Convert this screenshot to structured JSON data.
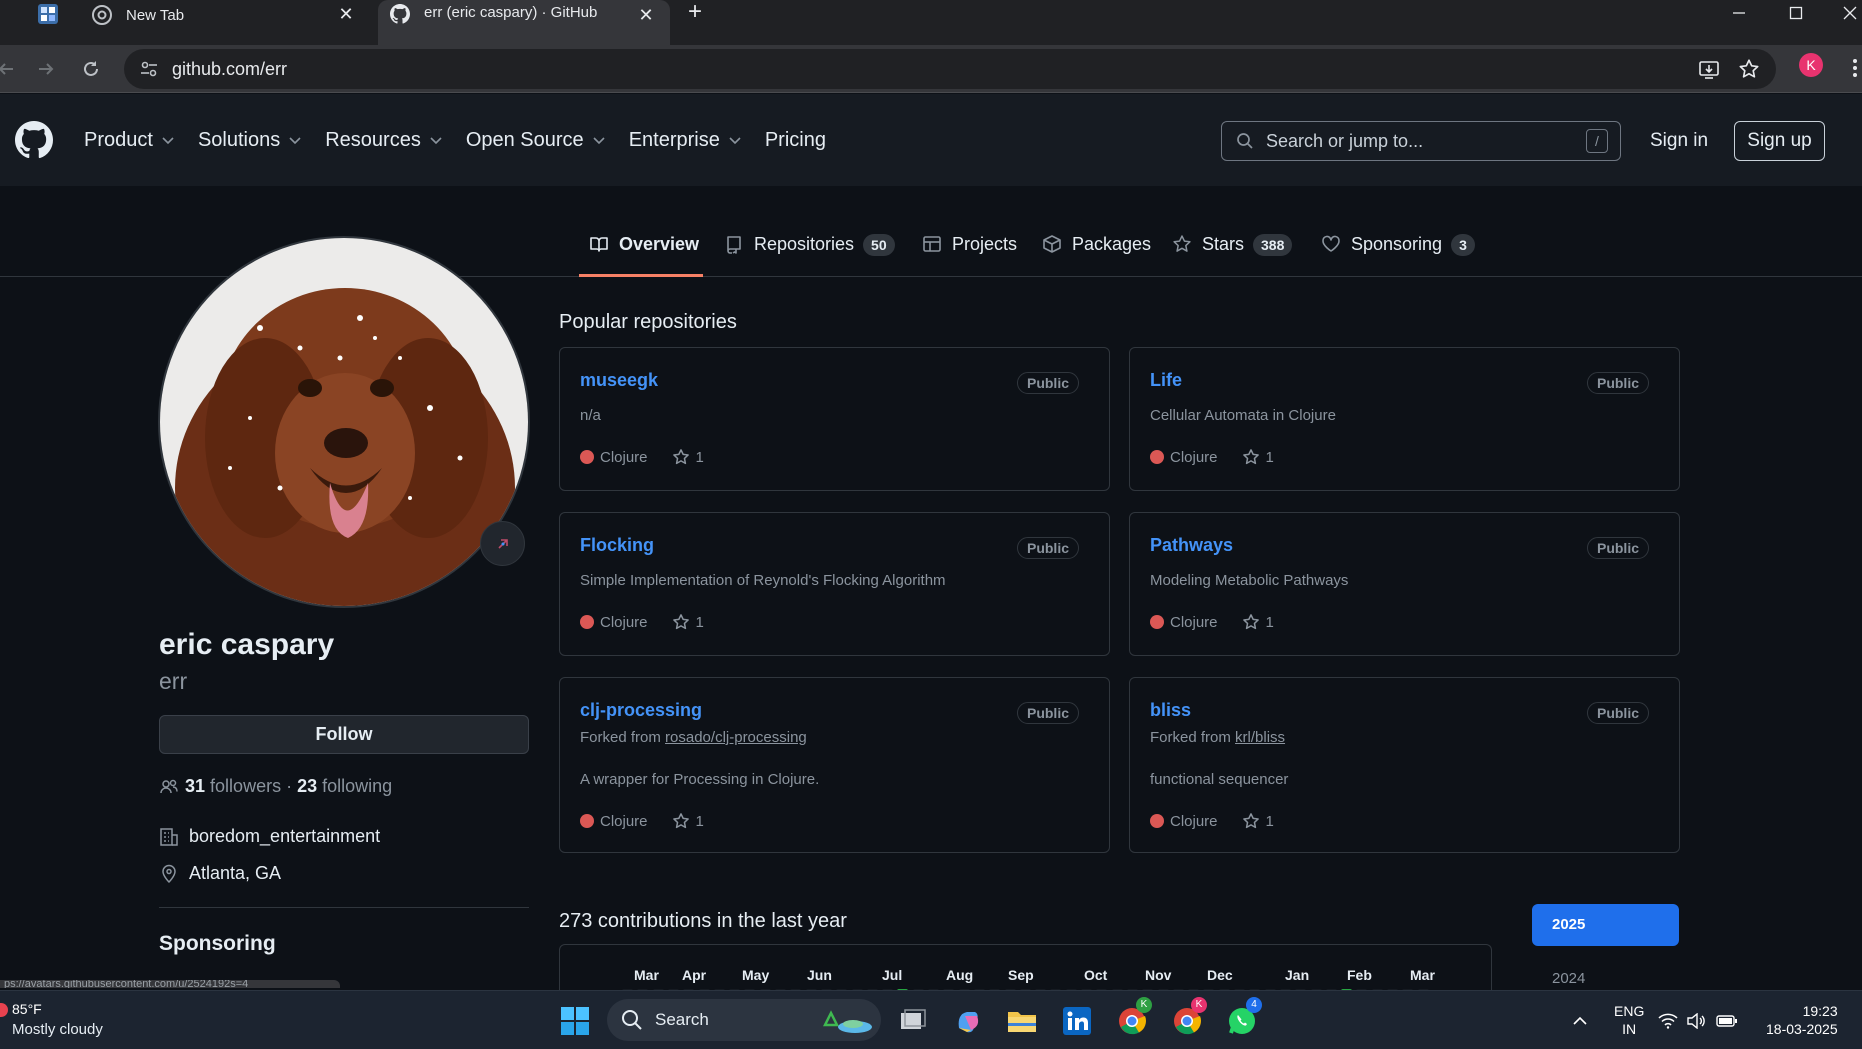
{
  "browser": {
    "tabs": [
      {
        "label": "New Tab"
      },
      {
        "label": "err (eric caspary) · GitHub"
      }
    ],
    "url": "github.com/err",
    "profile_initial": "K"
  },
  "gh_header": {
    "nav": [
      "Product",
      "Solutions",
      "Resources",
      "Open Source",
      "Enterprise",
      "Pricing"
    ],
    "search_placeholder": "Search or jump to...",
    "search_shortcut": "/",
    "sign_in": "Sign in",
    "sign_up": "Sign up"
  },
  "profile_tabs": [
    {
      "label": "Overview",
      "count": null
    },
    {
      "label": "Repositories",
      "count": "50"
    },
    {
      "label": "Projects",
      "count": null
    },
    {
      "label": "Packages",
      "count": null
    },
    {
      "label": "Stars",
      "count": "388"
    },
    {
      "label": "Sponsoring",
      "count": "3"
    }
  ],
  "profile": {
    "full_name": "eric caspary",
    "username": "err",
    "follow_label": "Follow",
    "followers_count": "31",
    "followers_label": "followers",
    "separator": "·",
    "following_count": "23",
    "following_label": "following",
    "company": "boredom_entertainment",
    "location": "Atlanta, GA",
    "sponsoring_title": "Sponsoring"
  },
  "popular": {
    "title": "Popular repositories",
    "repos": [
      {
        "name": "museegk",
        "visibility": "Public",
        "description": "n/a",
        "language": "Clojure",
        "stars": "1",
        "fork_prefix": "",
        "fork_link": ""
      },
      {
        "name": "Life",
        "visibility": "Public",
        "description": "Cellular Automata in Clojure",
        "language": "Clojure",
        "stars": "1",
        "fork_prefix": "",
        "fork_link": ""
      },
      {
        "name": "Flocking",
        "visibility": "Public",
        "description": "Simple Implementation of Reynold's Flocking Algorithm",
        "language": "Clojure",
        "stars": "1",
        "fork_prefix": "",
        "fork_link": ""
      },
      {
        "name": "Pathways",
        "visibility": "Public",
        "description": "Modeling Metabolic Pathways",
        "language": "Clojure",
        "stars": "1",
        "fork_prefix": "",
        "fork_link": ""
      },
      {
        "name": "clj-processing",
        "visibility": "Public",
        "description": "A wrapper for Processing in Clojure.",
        "language": "Clojure",
        "stars": "1",
        "fork_prefix": "Forked from",
        "fork_link": "rosado/clj-processing"
      },
      {
        "name": "bliss",
        "visibility": "Public",
        "description": "functional sequencer",
        "language": "Clojure",
        "stars": "1",
        "fork_prefix": "Forked from",
        "fork_link": "krl/bliss"
      }
    ]
  },
  "contributions": {
    "title": "273 contributions in the last year",
    "months": [
      "Mar",
      "Apr",
      "May",
      "Jun",
      "Jul",
      "Aug",
      "Sep",
      "Oct",
      "Nov",
      "Dec",
      "Jan",
      "Feb",
      "Mar"
    ],
    "years": [
      "2025",
      "2024"
    ],
    "selected_year": "2025"
  },
  "status_link": "ps://avatars.githubusercontent.com/u/2524192s=4",
  "taskbar": {
    "weather_temp": "85°F",
    "weather_desc": "Mostly cloudy",
    "search_label": "Search",
    "lang_top": "ENG",
    "lang_bottom": "IN",
    "time": "19:23",
    "date": "18-03-2025",
    "chrome_badge": "K",
    "whatsapp_badge": "4"
  },
  "colors": {
    "page_bg": "#0d1117",
    "link": "#4493f8",
    "clojure": "#db5855",
    "selected_tab_underline": "#f78166",
    "year_selected": "#1f6feb"
  }
}
